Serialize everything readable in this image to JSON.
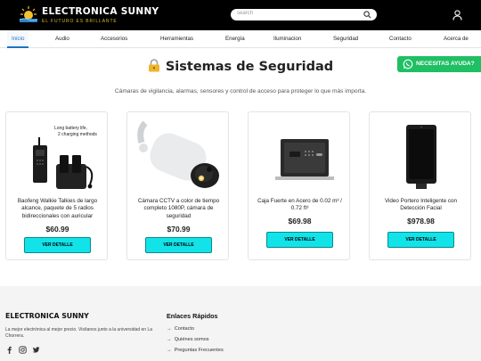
{
  "header": {
    "brand": "ELECTRONICA SUNNY",
    "tagline": "EL FUTURO ES BRILLANTE",
    "search_placeholder": "search"
  },
  "nav": {
    "items": [
      "Inicio",
      "Audio",
      "Accesorios",
      "Herramientas",
      "Energía",
      "Iluminacion",
      "Seguridad",
      "Contacto",
      "Acerca de"
    ],
    "active": "Inicio"
  },
  "page": {
    "title": "Sistemas de Seguridad",
    "subtitle": "Cámaras de vigilancia, alarmas, sensores y control de acceso para proteger lo que más importa."
  },
  "whatsapp": {
    "label": "NECESITAS AYUDA?"
  },
  "products": [
    {
      "name": "Baofeng Walkie Talkies de largo alcance, paquete de 5 radios bidireccionales con auricular",
      "price": "$60.99",
      "button": "VER DETALLE",
      "image_text_1": "Long battery life,",
      "image_text_2": "2 charging methods"
    },
    {
      "name": "Cámara CCTV a color de tiempo completo 1080P, cámara de seguridad",
      "price": "$70.99",
      "button": "VER DETALLE"
    },
    {
      "name": "Caja Fuerte en Acero de 0.02 m³ / 0.72 ft³",
      "price": "$69.98",
      "button": "VER DETALLE"
    },
    {
      "name": "Video Portero Inteligente con Detección Facial",
      "price": "$978.98",
      "button": "VER DETALLE"
    }
  ],
  "footer": {
    "brand": "ELECTRONICA SUNNY",
    "description": "La mejor electrónica al mejor precio. Visítanos junto a la universidad en La Chorrera.",
    "links_heading": "Enlaces Rápidos",
    "links": [
      "Contacto",
      "Quiénes somos",
      "Preguntas Frecuentes"
    ]
  },
  "colors": {
    "header_bg": "#000000",
    "accent_blue": "#1a73c8",
    "button_cyan": "#12e3e9",
    "whatsapp_green": "#1fbf63",
    "tagline_gold": "#d7bd2a"
  }
}
